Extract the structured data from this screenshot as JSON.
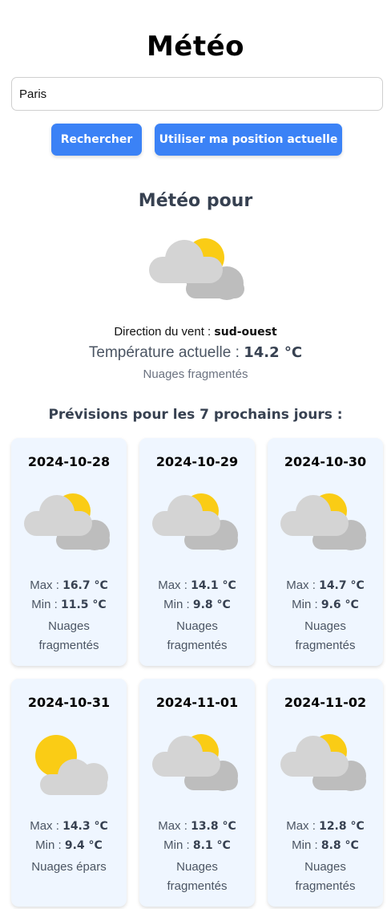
{
  "app": {
    "title": "Météo"
  },
  "search": {
    "value": "Paris",
    "placeholder": ""
  },
  "buttons": {
    "search_label": "Rechercher",
    "geo_label": "Utiliser ma position actuelle"
  },
  "colors": {
    "accent": "#3b82f6",
    "card_bg": "#eff6ff",
    "sun": "#facc15",
    "cloud_light": "#d4d4d4",
    "cloud_dark": "#bdbdbd"
  },
  "current": {
    "heading": "Météo pour",
    "icon": "broken-clouds-icon",
    "wind_label": "Direction du vent :",
    "wind_value": "sud-ouest",
    "temp_label": "Température actuelle :",
    "temp_value": "14.2 °C",
    "description": "Nuages fragmentés"
  },
  "forecast": {
    "heading": "Prévisions pour les 7 prochains jours :",
    "max_label": "Max :",
    "min_label": "Min :",
    "days": [
      {
        "date": "2024-10-28",
        "max": "16.7 °C",
        "min": "11.5 °C",
        "description": "Nuages fragmentés",
        "icon": "broken-clouds-icon"
      },
      {
        "date": "2024-10-29",
        "max": "14.1 °C",
        "min": "9.8 °C",
        "description": "Nuages fragmentés",
        "icon": "broken-clouds-icon"
      },
      {
        "date": "2024-10-30",
        "max": "14.7 °C",
        "min": "9.6 °C",
        "description": "Nuages fragmentés",
        "icon": "broken-clouds-icon"
      },
      {
        "date": "2024-10-31",
        "max": "14.3 °C",
        "min": "9.4 °C",
        "description": "Nuages épars",
        "icon": "scattered-clouds-icon"
      },
      {
        "date": "2024-11-01",
        "max": "13.8 °C",
        "min": "8.1 °C",
        "description": "Nuages fragmentés",
        "icon": "broken-clouds-icon"
      },
      {
        "date": "2024-11-02",
        "max": "12.8 °C",
        "min": "8.8 °C",
        "description": "Nuages fragmentés",
        "icon": "broken-clouds-icon"
      }
    ]
  }
}
